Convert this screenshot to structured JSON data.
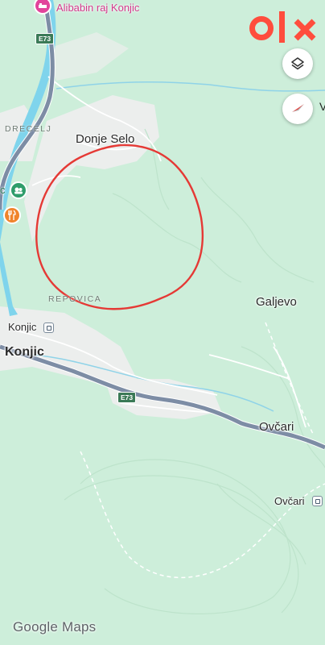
{
  "places": {
    "alibabin": "Alibabin raj Konjic",
    "drecelj": "DRECELJ",
    "donje_selo": "Donje Selo",
    "repovica": "REPOVICA",
    "galjevo": "Galjevo",
    "konjic_station": "Konjic",
    "konjic": "Konjic",
    "ovcari": "Ovčari",
    "ovcari_station": "Ovčari",
    "partial_c": "c",
    "partial_v": "V"
  },
  "roads": {
    "e73_top": "E73",
    "e73_mid": "E73"
  },
  "branding": {
    "google": "Google",
    "maps": "Maps",
    "olx": "olx"
  },
  "colors": {
    "land": "#cdeeda",
    "urban": "#eef0ef",
    "water": "#7fd4ec",
    "highway": "#7d8da5",
    "annotation_circle": "#e53935",
    "olx_red": "#ff4d3d",
    "food_pin": "#f0842c",
    "hotel_pin": "#e2449b",
    "park_pin": "#2f9d6b"
  },
  "icons": {
    "layers": "layers-icon",
    "compass": "compass-icon",
    "hotel": "hotel-pin-icon",
    "park": "park-pin-icon",
    "food": "restaurant-pin-icon",
    "station": "train-station-icon"
  }
}
